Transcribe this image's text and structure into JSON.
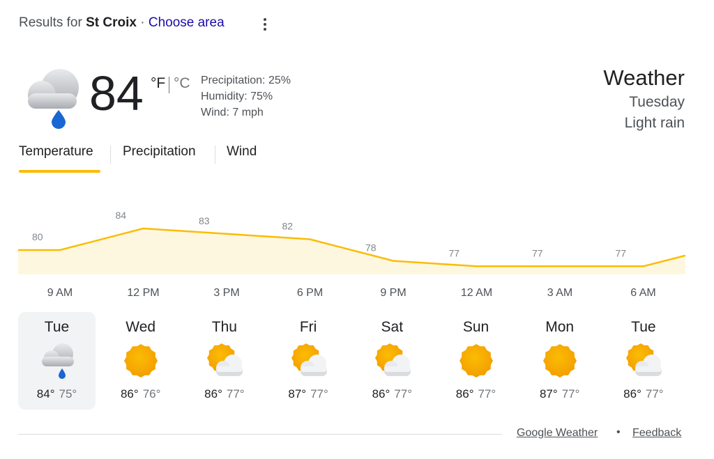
{
  "header": {
    "results_prefix": "Results for",
    "location": "St Croix",
    "separator": " · ",
    "choose_area": "Choose area"
  },
  "current": {
    "icon": "rain-cloud-icon",
    "temperature": "84",
    "unit_f": "°F",
    "unit_c": "°C",
    "precipitation": "Precipitation: 25%",
    "humidity": "Humidity: 75%",
    "wind": "Wind: 7 mph",
    "title": "Weather",
    "day": "Tuesday",
    "condition": "Light rain"
  },
  "tabs": [
    "Temperature",
    "Precipitation",
    "Wind"
  ],
  "colors": {
    "accent": "#fbbc04",
    "chart_fill": "#fef7e0",
    "link": "#1a0dab",
    "sun": "#f29900"
  },
  "chart_data": {
    "type": "area",
    "x": [
      "9 AM",
      "12 PM",
      "3 PM",
      "6 PM",
      "9 PM",
      "12 AM",
      "3 AM",
      "6 AM"
    ],
    "values": [
      80,
      84,
      83,
      82,
      78,
      77,
      77,
      77
    ],
    "labels": [
      "80",
      "84",
      "83",
      "82",
      "78",
      "77",
      "77",
      "77"
    ]
  },
  "days": [
    {
      "name": "Tue",
      "icon": "rain-cloud-icon",
      "hi": "84°",
      "lo": "75°",
      "selected": true
    },
    {
      "name": "Wed",
      "icon": "sun-icon",
      "hi": "86°",
      "lo": "76°",
      "selected": false
    },
    {
      "name": "Thu",
      "icon": "partly-cloudy-icon",
      "hi": "86°",
      "lo": "77°",
      "selected": false
    },
    {
      "name": "Fri",
      "icon": "partly-cloudy-icon",
      "hi": "87°",
      "lo": "77°",
      "selected": false
    },
    {
      "name": "Sat",
      "icon": "partly-cloudy-icon",
      "hi": "86°",
      "lo": "77°",
      "selected": false
    },
    {
      "name": "Sun",
      "icon": "sun-icon",
      "hi": "86°",
      "lo": "77°",
      "selected": false
    },
    {
      "name": "Mon",
      "icon": "sun-icon",
      "hi": "87°",
      "lo": "77°",
      "selected": false
    },
    {
      "name": "Tue",
      "icon": "partly-cloudy-icon",
      "hi": "86°",
      "lo": "77°",
      "selected": false
    }
  ],
  "footer": {
    "google_weather": "Google Weather",
    "dot": "•",
    "feedback": "Feedback"
  }
}
